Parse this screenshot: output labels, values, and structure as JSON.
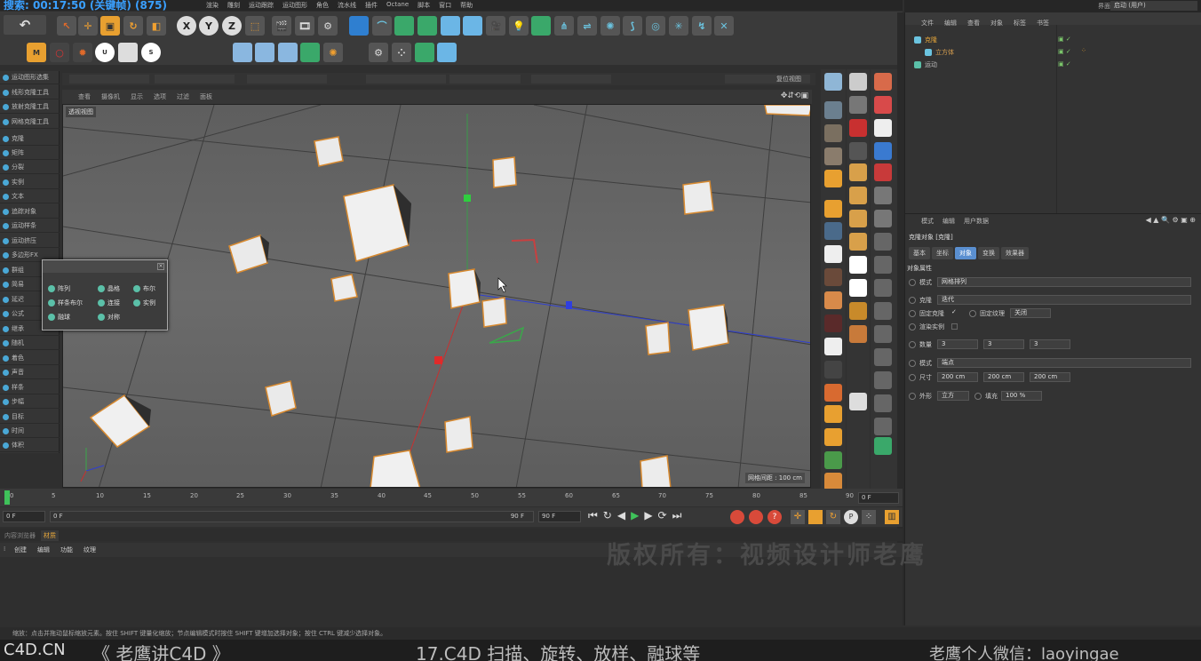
{
  "title_bar": {
    "title": "搜索: 00:17:50 (关键帧) (875)",
    "right_label": "界面:",
    "layout_value": "启动 (用户)"
  },
  "menu": [
    "渲染",
    "雕刻",
    "运动跟踪",
    "运动图形",
    "角色",
    "流水线",
    "插件",
    "Octane",
    "脚本",
    "窗口",
    "帮助"
  ],
  "toolbar": {
    "undo_glyph": "↶",
    "x_label": "X",
    "y_label": "Y",
    "z_label": "Z"
  },
  "left_panel": {
    "items": [
      "运动图形选集",
      "线形克隆工具",
      "放射克隆工具",
      "网格克隆工具",
      "克隆",
      "矩阵",
      "分裂",
      "实例",
      "文本",
      "追踪对象",
      "运动样条",
      "运动挤压",
      "多边形FX",
      "群组",
      "简易",
      "延迟",
      "公式",
      "继承",
      "随机",
      "着色",
      "声音",
      "样条",
      "步幅",
      "目标",
      "时间",
      "体积"
    ]
  },
  "viewport": {
    "menu": [
      "查看",
      "摄像机",
      "显示",
      "选项",
      "过滤",
      "面板"
    ],
    "view_label": "透视视图",
    "grid_note": "网格间距 : 100 cm",
    "reset_label": "复位视图"
  },
  "palette": {
    "items": [
      "阵列",
      "晶格",
      "布尔",
      "样条布尔",
      "连接",
      "实例",
      "融球",
      "对称"
    ]
  },
  "object_manager": {
    "menu": [
      "文件",
      "编辑",
      "查看",
      "对象",
      "标签",
      "书签"
    ],
    "rows": [
      "克隆",
      "立方体",
      "运动"
    ]
  },
  "attributes": {
    "menu": [
      "模式",
      "编辑",
      "用户数据"
    ],
    "title": "克隆对象 [克隆]",
    "tabs": [
      "基本",
      "坐标",
      "对象",
      "变换",
      "效果器"
    ],
    "active_tab": "对象",
    "section": "对象属性",
    "mode_label": "模式",
    "mode_value": "网格排列",
    "clone_label": "克隆",
    "clone_value": "迭代",
    "fixed_clone_label": "固定克隆",
    "fixed_texture_label": "固定纹理",
    "fixed_texture_value": "关闭",
    "render_instance_label": "渲染实例",
    "count_label": "数量",
    "count_values": [
      "3",
      "3",
      "3"
    ],
    "mode2_label": "模式",
    "mode2_value": "端点",
    "size_label": "尺寸",
    "size_values": [
      "200 cm",
      "200 cm",
      "200 cm"
    ],
    "shape_label": "外形",
    "shape_value": "立方",
    "fill_label": "填充",
    "fill_value": "100 %"
  },
  "timeline": {
    "ticks": [
      "0",
      "5",
      "10",
      "15",
      "20",
      "25",
      "30",
      "35",
      "40",
      "45",
      "50",
      "55",
      "60",
      "65",
      "70",
      "75",
      "80",
      "85",
      "90"
    ],
    "current_frame": "0 F",
    "start_frame": "0 F",
    "range_start": "0 F",
    "range_end": "90 F",
    "end_frame": "90 F"
  },
  "materials": {
    "tabs": [
      "内容浏览器",
      "材质"
    ],
    "active_tab": "材质",
    "menu": [
      "创建",
      "编辑",
      "功能",
      "纹理"
    ]
  },
  "watermark": "版权所有：视频设计师老鹰",
  "status_text": "缩放：点击并拖动鼠标缩放元素。按住 SHIFT 键量化缩放；节点编辑模式时按住 SHIFT 键增加选择对象；按住 CTRL 键减少选择对象。",
  "caption": {
    "site": "C4D.CN",
    "course": "《 老鹰讲C4D 》",
    "lesson": "17.C4D 扫描、旋转、放样、融球等",
    "wechat": "老鹰个人微信：laoyingae"
  },
  "colors": {
    "accent_blue": "#3aa0ff",
    "object_orange": "#e6a63a",
    "active_tab": "#5a8fd0",
    "play_green": "#3fc25a"
  }
}
